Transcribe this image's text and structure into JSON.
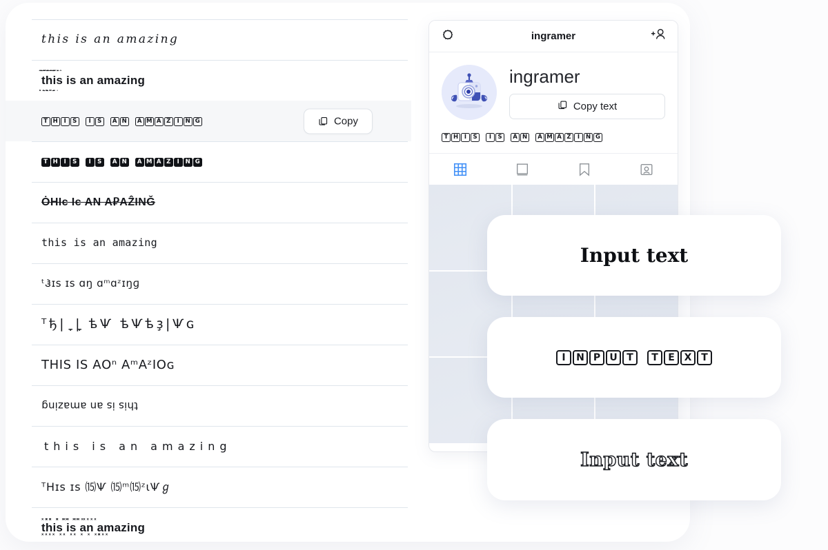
{
  "app": {
    "background_color": "#fbfbfc",
    "panel_color": "#ffffff",
    "divider_color": "#dfe5ec",
    "accent_color": "#3f8ff7",
    "highlight_row_color": "#f6f7f9"
  },
  "font_list": {
    "sample_phrase": "this is an amazing",
    "rows": [
      {
        "id": "script",
        "style": "script-italic",
        "text": "this is an amazing",
        "highlighted": false,
        "has_copy_button": false
      },
      {
        "id": "zalgo",
        "style": "zalgo-glitch",
        "text": "this is an amazing",
        "highlighted": false,
        "has_copy_button": false
      },
      {
        "id": "box-outline",
        "style": "squared-outline",
        "text": "THIS IS AN AMAZING",
        "highlighted": true,
        "has_copy_button": true,
        "copy_label": "Copy"
      },
      {
        "id": "box-filled",
        "style": "squared-filled",
        "text": "THIS IS AN AMAZING",
        "highlighted": false,
        "has_copy_button": false
      },
      {
        "id": "strikethrough",
        "style": "strikethrough",
        "text": "THIS IS AN AMAZING",
        "highlighted": false,
        "has_copy_button": false
      },
      {
        "id": "typewriter",
        "style": "monospace",
        "text": "this is an amazing",
        "highlighted": false,
        "has_copy_button": false
      },
      {
        "id": "smallcaps",
        "style": "small-caps",
        "text": "THIS IS AN AMAZING",
        "highlighted": false,
        "has_copy_button": false
      },
      {
        "id": "runic",
        "style": "runic-symbols",
        "text": "THIS IS AN AMAZING",
        "highlighted": false,
        "has_copy_button": false
      },
      {
        "id": "wide-round",
        "style": "rounded-caps",
        "text": "THIS IS AN AMAZING",
        "highlighted": false,
        "has_copy_button": false
      },
      {
        "id": "upside-down",
        "style": "upside-down",
        "text": "this is an amazing",
        "highlighted": false,
        "has_copy_button": false
      },
      {
        "id": "spaced",
        "style": "letter-spaced",
        "text": "this is an amazing",
        "highlighted": false,
        "has_copy_button": false
      },
      {
        "id": "circled-mix",
        "style": "circled-mixed",
        "text": "THIS IS AN AMAZING",
        "highlighted": false,
        "has_copy_button": false
      },
      {
        "id": "cross-marks",
        "style": "cross-diacritics",
        "text": "this is an amazing",
        "highlighted": false,
        "has_copy_button": false
      }
    ]
  },
  "phone": {
    "header": {
      "left_icon": "camera-shutter-icon",
      "title": "ingramer",
      "right_icon": "add-person-icon"
    },
    "profile": {
      "avatar_icon": "camera-robot-avatar",
      "username": "ingramer",
      "copy_text_label": "Copy text",
      "copy_icon": "copy-icon",
      "bio": "THIS IS AN AMAZING"
    },
    "tabs": [
      {
        "id": "grid",
        "icon": "grid-icon",
        "active": true
      },
      {
        "id": "reels",
        "icon": "frame-icon",
        "active": false
      },
      {
        "id": "saved",
        "icon": "bookmark-icon",
        "active": false
      },
      {
        "id": "tagged",
        "icon": "tagged-icon",
        "active": false
      }
    ],
    "grid_cells": 9
  },
  "preview_cards": [
    {
      "id": "card-serif",
      "text": "Input text",
      "style": "bold-serif"
    },
    {
      "id": "card-boxed",
      "text": "INPUT TEXT",
      "style": "squared-outline"
    },
    {
      "id": "card-outline",
      "text": "Input text",
      "style": "outlined-serif"
    }
  ]
}
